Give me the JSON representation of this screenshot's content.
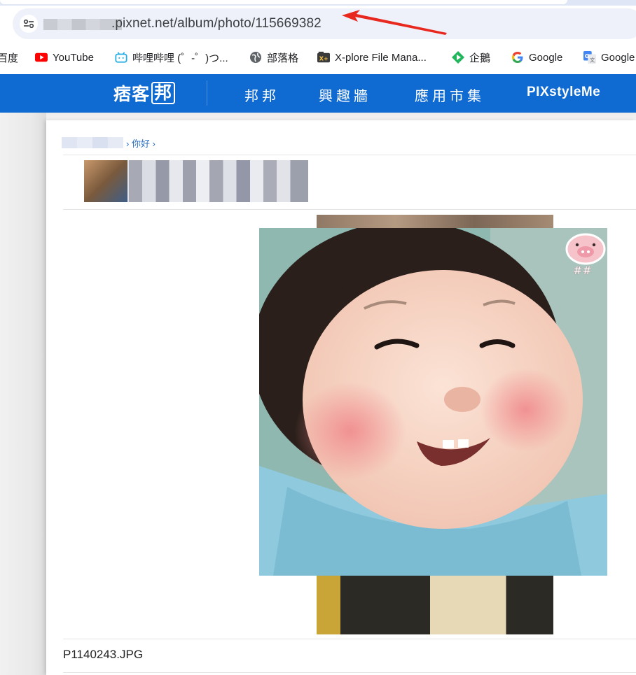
{
  "browser": {
    "url_visible": ".pixnet.net/album/photo/115669382"
  },
  "bookmarks": [
    {
      "label": "百度",
      "icon": "baidu-icon"
    },
    {
      "label": "YouTube",
      "icon": "youtube-icon"
    },
    {
      "label": "哔哩哔哩 (゜-゜)つ...",
      "icon": "bilibili-icon"
    },
    {
      "label": "部落格",
      "icon": "globe-icon"
    },
    {
      "label": "X-plore File Mana...",
      "icon": "xplore-icon"
    },
    {
      "label": "企鵝",
      "icon": "tencent-video-icon"
    },
    {
      "label": "Google",
      "icon": "google-icon"
    },
    {
      "label": "Google",
      "icon": "google-translate-icon"
    }
  ],
  "site": {
    "logo_text_a": "痞客",
    "logo_text_b": "邦",
    "nav": [
      "邦邦",
      "興趣牆",
      "應用市集",
      "PIXstyleMe"
    ]
  },
  "page": {
    "breadcrumb_tail": "› 你好 ›",
    "filename": "P1140243.JPG"
  },
  "colors": {
    "nav_blue": "#0f6ad1",
    "arrow_red": "#e8281e"
  }
}
